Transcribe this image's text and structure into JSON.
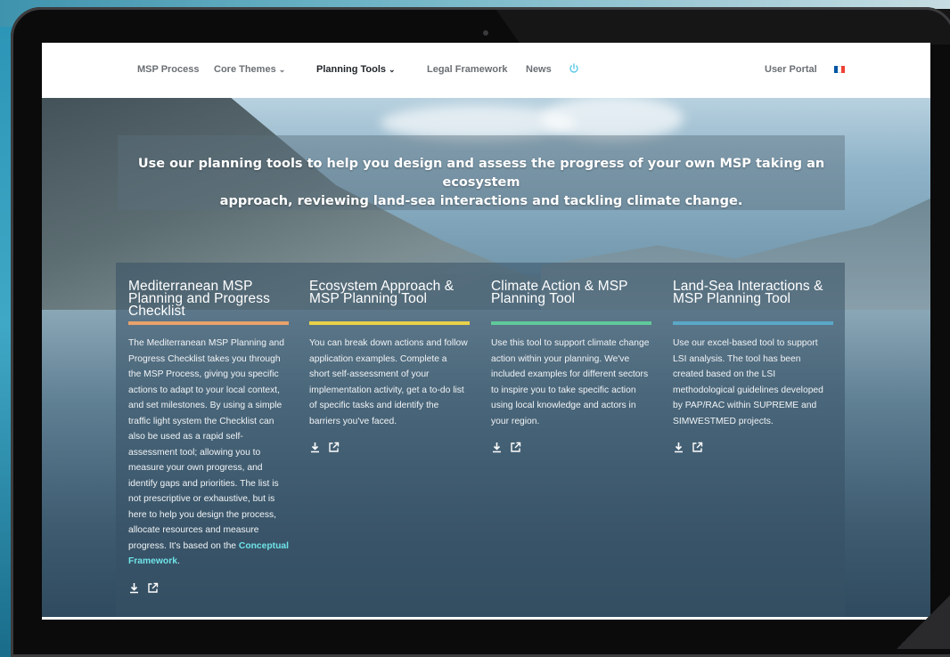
{
  "nav": {
    "items": [
      {
        "label": "MSP Process",
        "has_dropdown": false,
        "active": false
      },
      {
        "label": "Core Themes",
        "has_dropdown": true,
        "active": false
      },
      {
        "label": "Planning Tools",
        "has_dropdown": true,
        "active": true
      },
      {
        "label": "Legal Framework",
        "has_dropdown": false,
        "active": false
      },
      {
        "label": "News",
        "has_dropdown": false,
        "active": false
      }
    ],
    "user_portal": "User Portal",
    "chevron": "⌄",
    "power_icon": "power-icon",
    "flag_icon": "french-flag-icon",
    "flag_colors": [
      "#0055a4",
      "#ffffff",
      "#ef4135"
    ],
    "accent": "#5bc8e8"
  },
  "hero": {
    "text_line1": "Use our planning tools to help you design and assess the progress of your own MSP taking an ecosystem",
    "text_line2": "approach, reviewing land-sea interactions and tackling climate change."
  },
  "cards": [
    {
      "title": "Mediterranean MSP Planning and Progress Checklist",
      "bar_color": "#e8a26a",
      "description": "The Mediterranean MSP Planning and Progress Checklist takes you through the MSP Process, giving you specific actions to adapt to your local context, and set milestones. By using a simple traffic light system the Checklist can also be used as a rapid self-assessment tool; allowing you to measure your own progress, and identify gaps and priorities. The list is not prescriptive or exhaustive, but is here to help you design the process, allocate resources and measure progress. It's based on the ",
      "link": "Conceptual Framework",
      "suffix": "."
    },
    {
      "title": "Ecosystem Approach & MSP Planning Tool",
      "bar_color": "#e8d24a",
      "description": "You can break down actions and follow application examples. Complete a short self-assessment of your implementation activity, get a to-do list of specific tasks and identify the barriers you've faced."
    },
    {
      "title": "Climate Action & MSP Planning Tool",
      "bar_color": "#5fc99a",
      "description": "Use this tool to support climate change action within your planning. We've included examples for different sectors to inspire you to take specific action using local knowledge and actors in your region."
    },
    {
      "title": "Land-Sea Interactions & MSP Planning Tool",
      "bar_color": "#5aa9c8",
      "description": "Use our excel-based tool to support LSI analysis. The tool has been created based on the LSI methodological guidelines developed by PAP/RAC within SUPREME and SIMWESTMED projects."
    }
  ],
  "icons": {
    "download": "download-icon",
    "external": "external-link-icon"
  }
}
